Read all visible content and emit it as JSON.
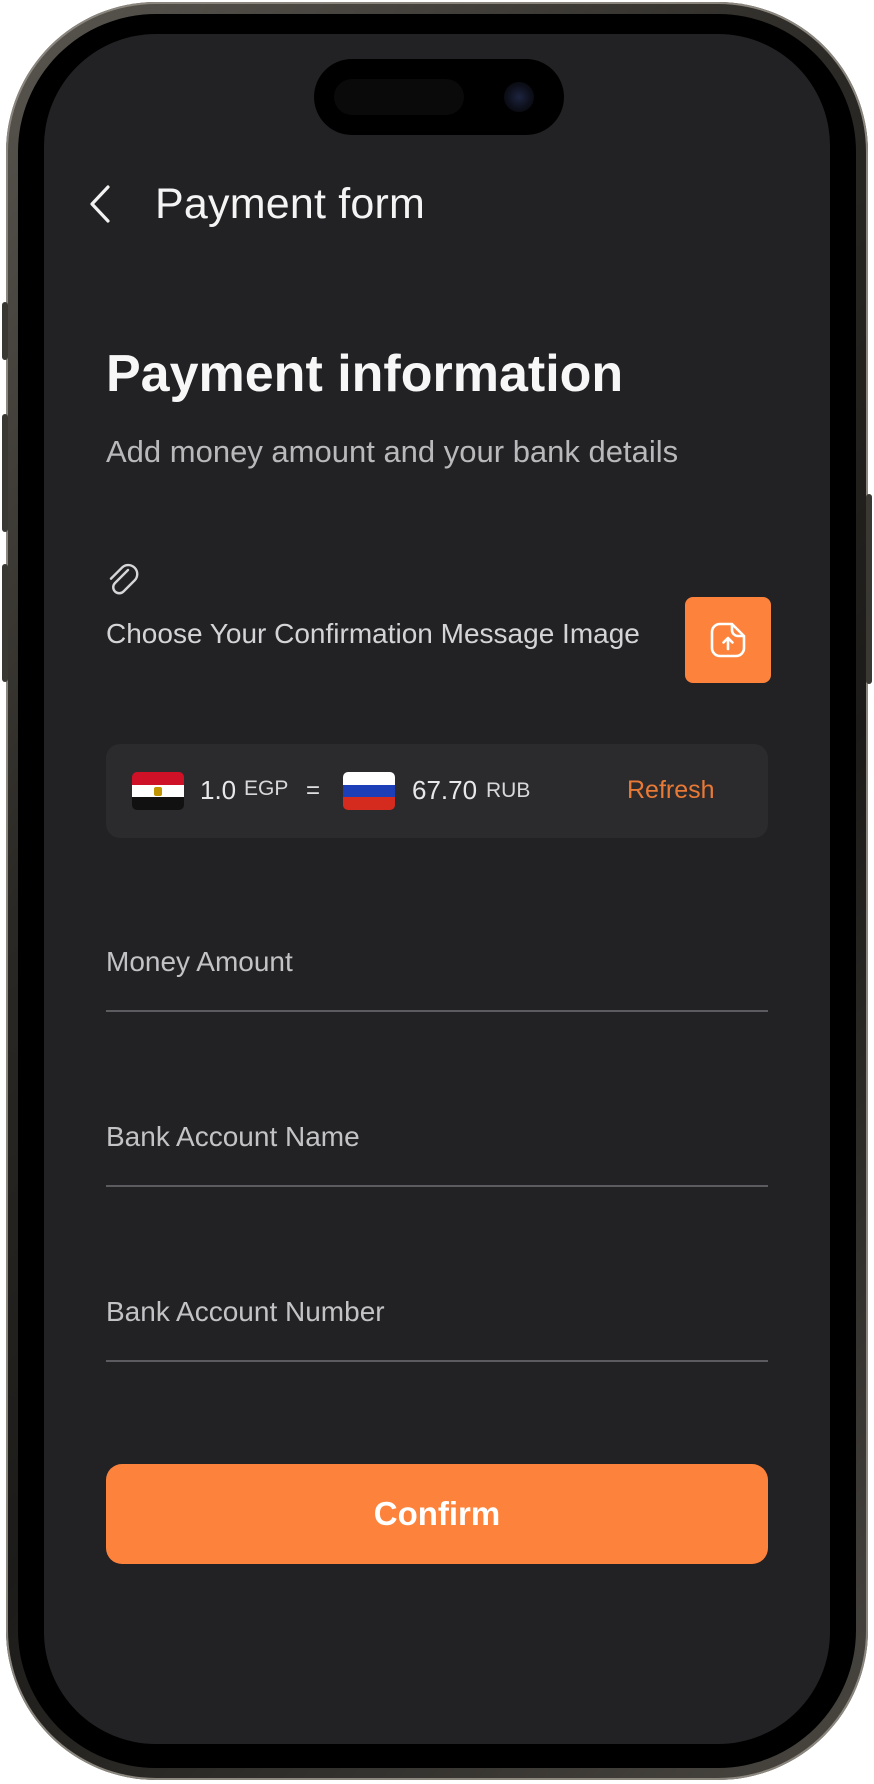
{
  "header": {
    "title": "Payment form",
    "back_icon": "chevron-left-icon"
  },
  "section": {
    "title": "Payment information",
    "subtitle": "Add money amount and your bank details"
  },
  "attachment": {
    "icon": "paperclip-icon",
    "label": "Choose Your Confirmation Message Image",
    "upload_icon": "file-upload-icon"
  },
  "exchange_rate": {
    "from_amount": "1.0",
    "from_currency": "EGP",
    "equals": "=",
    "to_amount": "67.70",
    "to_currency": "RUB",
    "refresh_label": "Refresh"
  },
  "fields": {
    "money_amount": {
      "placeholder": "Money Amount",
      "value": ""
    },
    "bank_account_name": {
      "placeholder": "Bank Account Name",
      "value": ""
    },
    "bank_account_number": {
      "placeholder": "Bank Account Number",
      "value": ""
    }
  },
  "confirm_label": "Confirm",
  "colors": {
    "accent": "#fd823b",
    "background": "#222124",
    "card": "#2b2a2d",
    "refresh": "#e97a36"
  }
}
